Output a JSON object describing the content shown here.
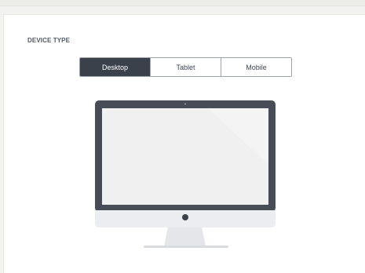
{
  "device_type": {
    "title": "DEVICE TYPE",
    "options": [
      {
        "label": "Desktop",
        "selected": true
      },
      {
        "label": "Tablet",
        "selected": false
      },
      {
        "label": "Mobile",
        "selected": false
      }
    ]
  },
  "preview": {
    "device": "desktop-monitor-icon",
    "colors": {
      "bezel": "#474c57",
      "screen": "#f0f0f0",
      "chin": "#ebedf1",
      "stand": "#e4e6ea",
      "button": "#3b414b"
    }
  }
}
